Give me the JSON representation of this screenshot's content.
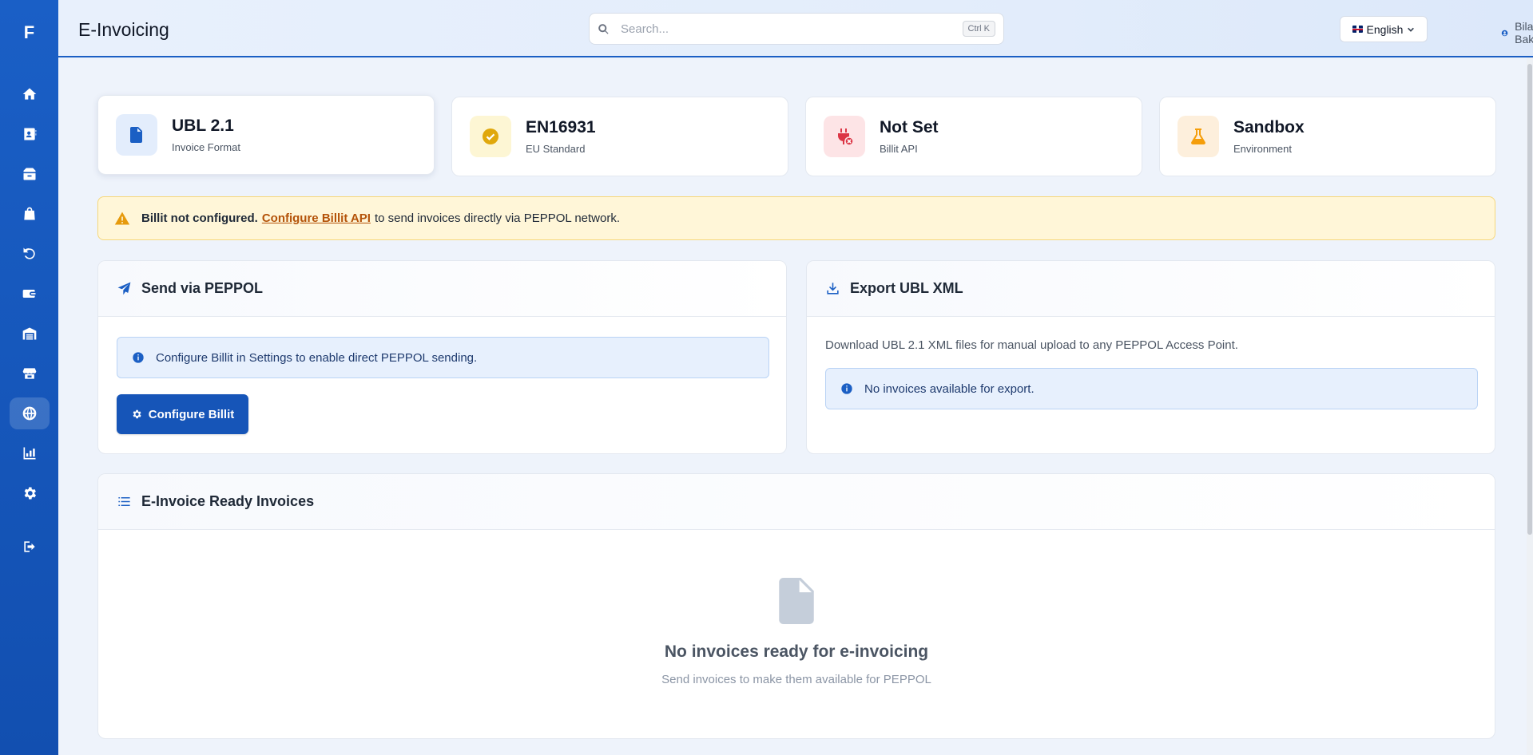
{
  "app": {
    "logo_letter": "F",
    "page_title": "E-Invoicing"
  },
  "header": {
    "search_placeholder": "Search...",
    "search_shortcut": "Ctrl K",
    "language": "English",
    "user_name": "Bilal Bakir"
  },
  "sidebar": {
    "items": [
      {
        "icon": "home-icon",
        "active": false
      },
      {
        "icon": "contacts-icon",
        "active": false
      },
      {
        "icon": "box-icon",
        "active": false
      },
      {
        "icon": "shopping-bag-icon",
        "active": false
      },
      {
        "icon": "undo-icon",
        "active": false
      },
      {
        "icon": "wallet-icon",
        "active": false
      },
      {
        "icon": "warehouse-icon",
        "active": false
      },
      {
        "icon": "store-icon",
        "active": false
      },
      {
        "icon": "globe-icon",
        "active": true
      },
      {
        "icon": "chart-icon",
        "active": false
      },
      {
        "icon": "gear-icon",
        "active": false
      },
      {
        "icon": "logout-icon",
        "active": false
      }
    ]
  },
  "stats": [
    {
      "value": "UBL 2.1",
      "label": "Invoice Format",
      "icon": "file-code-icon",
      "color": "#1b5fc4",
      "bg": "#e3edfc"
    },
    {
      "value": "EN16931",
      "label": "EU Standard",
      "icon": "check-circle-icon",
      "color": "#e0a80c",
      "bg": "#fdf6d4"
    },
    {
      "value": "Not Set",
      "label": "Billit API",
      "icon": "plug-x-icon",
      "color": "#dc3545",
      "bg": "#fde4e6"
    },
    {
      "value": "Sandbox",
      "label": "Environment",
      "icon": "flask-icon",
      "color": "#f59e0b",
      "bg": "#fdefdc"
    }
  ],
  "alert": {
    "bold": "Billit not configured.",
    "link": "Configure Billit API",
    "rest": "to send invoices directly via PEPPOL network."
  },
  "peppol_panel": {
    "title": "Send via PEPPOL",
    "info": "Configure Billit in Settings to enable direct PEPPOL sending.",
    "button": "Configure Billit"
  },
  "export_panel": {
    "title": "Export UBL XML",
    "description": "Download UBL 2.1 XML files for manual upload to any PEPPOL Access Point.",
    "info": "No invoices available for export."
  },
  "ready_panel": {
    "title": "E-Invoice Ready Invoices",
    "empty_title": "No invoices ready for e-invoicing",
    "empty_sub": "Send invoices to make them available for PEPPOL"
  }
}
